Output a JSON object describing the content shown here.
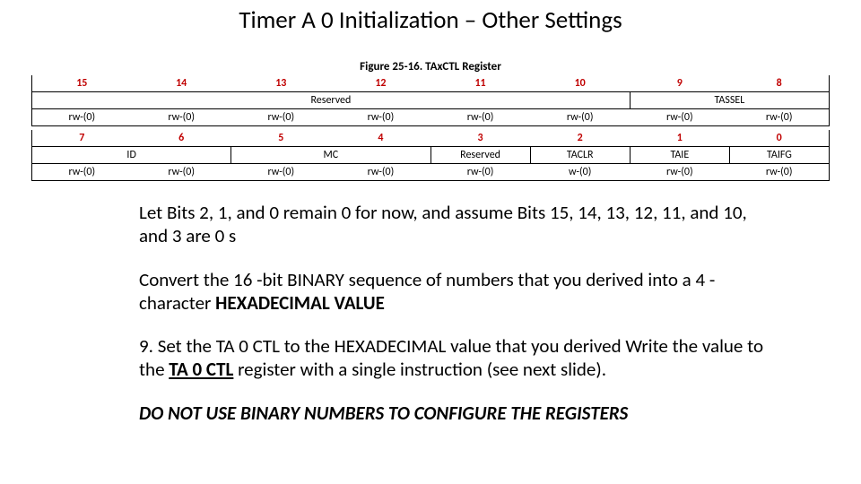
{
  "title": "Timer A 0 Initialization – Other Settings",
  "figure_caption": "Figure 25-16. TAxCTL Register",
  "reg": {
    "rows": [
      {
        "type": "bits",
        "cells": [
          "15",
          "14",
          "13",
          "12",
          "11",
          "10",
          "9",
          "8"
        ]
      },
      {
        "type": "names",
        "cells": [
          {
            "text": "Reserved",
            "span": 6
          },
          {
            "text": "TASSEL",
            "span": 2
          }
        ]
      },
      {
        "type": "rw",
        "cells": [
          "rw-(0)",
          "rw-(0)",
          "rw-(0)",
          "rw-(0)",
          "rw-(0)",
          "rw-(0)",
          "rw-(0)",
          "rw-(0)"
        ]
      },
      {
        "type": "bits",
        "cells": [
          "7",
          "6",
          "5",
          "4",
          "3",
          "2",
          "1",
          "0"
        ]
      },
      {
        "type": "names",
        "cells": [
          {
            "text": "ID",
            "span": 2
          },
          {
            "text": "MC",
            "span": 2
          },
          {
            "text": "Reserved",
            "span": 1
          },
          {
            "text": "TACLR",
            "span": 1
          },
          {
            "text": "TAIE",
            "span": 1
          },
          {
            "text": "TAIFG",
            "span": 1
          }
        ]
      },
      {
        "type": "rw",
        "cells": [
          "rw-(0)",
          "rw-(0)",
          "rw-(0)",
          "rw-(0)",
          "rw-(0)",
          "w-(0)",
          "rw-(0)",
          "rw-(0)"
        ]
      }
    ]
  },
  "para1": "Let Bits 2, 1, and 0 remain 0 for now, and assume Bits 15, 14, 13, 12, 11, and 10, and 3 are 0 s",
  "para2a": "Convert the 16 -bit BINARY sequence of numbers that you derived into a 4 -character ",
  "para2b": "HEXADECIMAL VALUE",
  "para3a": "9.  Set the TA 0 CTL to the HEXADECIMAL value that you derived Write the value to the ",
  "para3b": "TA 0 CTL",
  "para3c": " register with a single instruction (see next slide).",
  "para4": "DO NOT USE BINARY NUMBERS TO CONFIGURE THE REGISTERS"
}
